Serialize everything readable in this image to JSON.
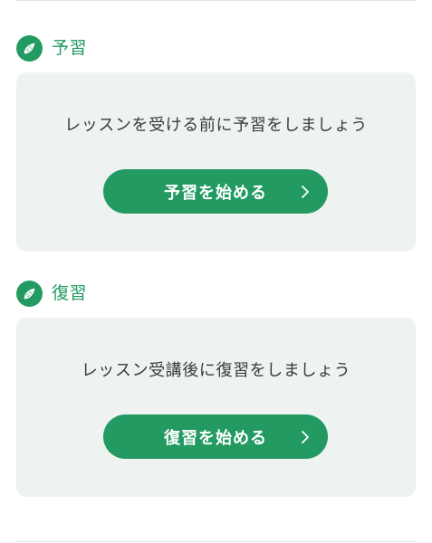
{
  "preview": {
    "title": "予習",
    "icon": "pencil-icon",
    "message": "レッスンを受ける前に予習をしましょう",
    "button_label": "予習を始める",
    "button_icon": "chevron-right-icon"
  },
  "review": {
    "title": "復習",
    "icon": "pencil-icon",
    "message": "レッスン受講後に復習をしましょう",
    "button_label": "復習を始める",
    "button_icon": "chevron-right-icon"
  },
  "colors": {
    "accent": "#229a62",
    "card_background": "#eef3f2",
    "text": "#3a3a3a"
  }
}
